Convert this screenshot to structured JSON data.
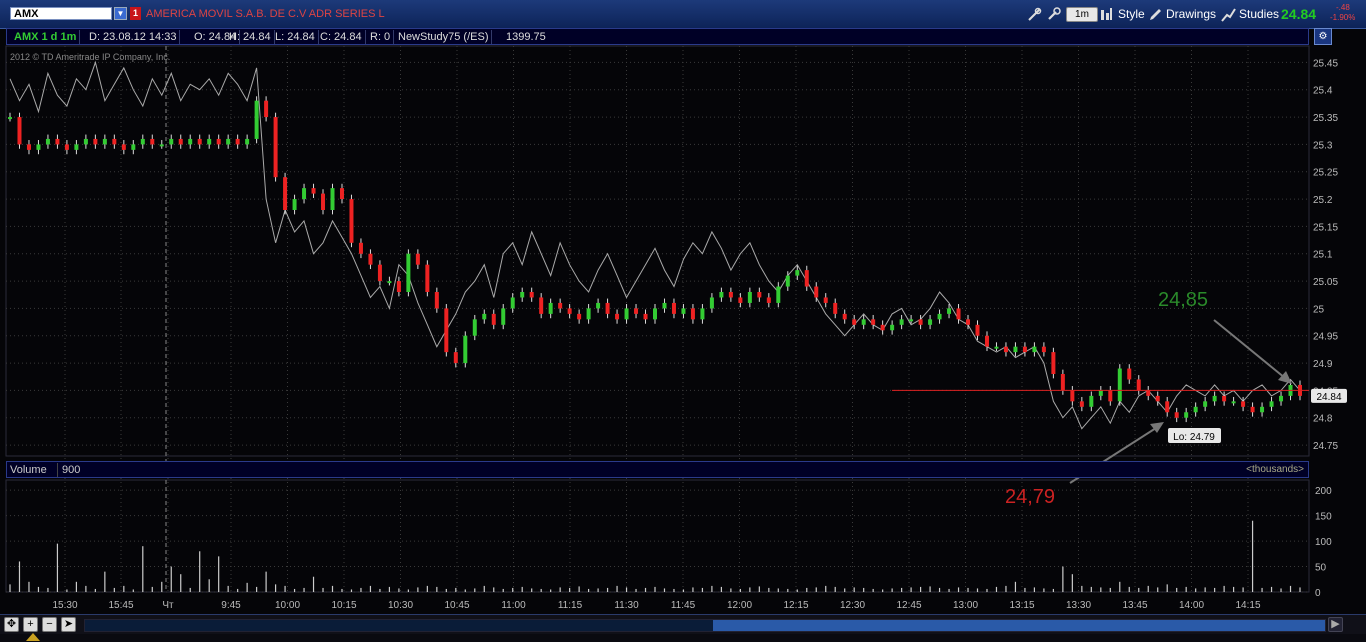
{
  "toolbar": {
    "symbol": "AMX",
    "company": "AMERICA MOVIL S.A.B. DE C.V ADR SERIES L",
    "interval": "1m",
    "style_label": "Style",
    "drawings_label": "Drawings",
    "studies_label": "Studies",
    "last_price": "24.84",
    "change_abs": "-.48",
    "change_pct": "-1.90%"
  },
  "info_bar": {
    "symbol_period": "AMX 1 d 1m",
    "date": "D: 23.08.12 14:33",
    "open": "O: 24.84",
    "high": "H: 24.84",
    "low": "L: 24.84",
    "close": "C: 24.84",
    "range": "R: 0",
    "study": "NewStudy75 (/ES)",
    "study_value": "1399.75"
  },
  "copyright": "2012 © TD Ameritrade IP Company, Inc.",
  "volume_panel": {
    "label": "Volume",
    "value": "900",
    "units": "<thousands>",
    "ticks": [
      "200",
      "150",
      "100",
      "50",
      "0"
    ]
  },
  "price_axis": {
    "ticks": [
      "25.45",
      "25.4",
      "25.35",
      "25.3",
      "25.25",
      "25.2",
      "25.15",
      "25.1",
      "25.05",
      "25",
      "24.95",
      "24.9",
      "24.85",
      "24.8",
      "24.75"
    ],
    "current_label": "24.84"
  },
  "time_axis": {
    "ticks": [
      "15:30",
      "15:45",
      "Чт",
      "9:45",
      "10:00",
      "10:15",
      "10:30",
      "10:45",
      "11:00",
      "11:15",
      "11:30",
      "11:45",
      "12:00",
      "12:15",
      "12:30",
      "12:45",
      "13:00",
      "13:15",
      "13:30",
      "13:45",
      "14:00",
      "14:15"
    ]
  },
  "annotations": {
    "low_label": "Lo: 24.79",
    "high_note": "24,85",
    "low_note": "24,79"
  },
  "colors": {
    "up": "#33cc33",
    "down": "#ee2222",
    "study_line": "#aaaaaa",
    "grid": "#3a3a3a",
    "axis_text": "#bbbbbb",
    "high_note": "#2a8a2a",
    "low_note": "#cc2222"
  },
  "chart_data": {
    "type": "line",
    "ylim": [
      24.73,
      25.48
    ],
    "close": [
      25.35,
      25.3,
      25.29,
      25.3,
      25.31,
      25.3,
      25.29,
      25.3,
      25.31,
      25.3,
      25.31,
      25.3,
      25.29,
      25.3,
      25.31,
      25.3,
      25.3,
      25.31,
      25.3,
      25.31,
      25.3,
      25.31,
      25.3,
      25.31,
      25.3,
      25.31,
      25.38,
      25.35,
      25.24,
      25.18,
      25.2,
      25.22,
      25.21,
      25.18,
      25.22,
      25.2,
      25.12,
      25.1,
      25.08,
      25.05,
      25.05,
      25.03,
      25.1,
      25.08,
      25.03,
      25.0,
      24.92,
      24.9,
      24.95,
      24.98,
      24.99,
      24.97,
      25.0,
      25.02,
      25.03,
      25.02,
      24.99,
      25.01,
      25.0,
      24.99,
      24.98,
      25.0,
      25.01,
      24.99,
      24.98,
      25.0,
      24.99,
      24.98,
      25.0,
      25.01,
      24.99,
      25.0,
      24.98,
      25.0,
      25.02,
      25.03,
      25.02,
      25.01,
      25.03,
      25.02,
      25.01,
      25.04,
      25.06,
      25.07,
      25.04,
      25.02,
      25.01,
      24.99,
      24.98,
      24.97,
      24.98,
      24.97,
      24.96,
      24.97,
      24.98,
      24.98,
      24.97,
      24.98,
      24.99,
      25.0,
      24.98,
      24.97,
      24.95,
      24.93,
      24.93,
      24.92,
      24.93,
      24.92,
      24.93,
      24.92,
      24.88,
      24.85,
      24.83,
      24.82,
      24.84,
      24.85,
      24.83,
      24.89,
      24.87,
      24.85,
      24.84,
      24.83,
      24.81,
      24.8,
      24.81,
      24.82,
      24.83,
      24.84,
      24.83,
      24.83,
      24.82,
      24.81,
      24.82,
      24.83,
      24.84,
      24.86,
      24.84
    ],
    "study_line": [
      25.42,
      25.38,
      25.41,
      25.36,
      25.43,
      25.39,
      25.37,
      25.42,
      25.4,
      25.45,
      25.38,
      25.41,
      25.44,
      25.4,
      25.37,
      25.42,
      25.39,
      25.43,
      25.38,
      25.41,
      25.4,
      25.42,
      25.39,
      25.43,
      25.41,
      25.38,
      25.44,
      25.2,
      25.12,
      25.18,
      25.14,
      25.16,
      25.1,
      25.12,
      25.16,
      25.13,
      25.1,
      25.06,
      25.02,
      25.04,
      25.0,
      25.08,
      25.06,
      25.01,
      24.97,
      24.93,
      24.96,
      24.99,
      25.03,
      25.05,
      25.08,
      25.02,
      25.1,
      25.12,
      25.08,
      25.14,
      25.1,
      25.06,
      25.12,
      25.08,
      25.05,
      25.03,
      25.07,
      25.1,
      25.06,
      25.02,
      25.05,
      25.08,
      25.11,
      25.07,
      25.04,
      25.09,
      25.12,
      25.1,
      25.14,
      25.11,
      25.07,
      25.1,
      25.12,
      25.08,
      25.05,
      25.03,
      25.06,
      25.08,
      25.05,
      25.02,
      24.99,
      24.97,
      24.95,
      24.97,
      24.99,
      24.97,
      24.96,
      24.99,
      25.0,
      24.97,
      24.98,
      25.0,
      25.03,
      25.01,
      24.98,
      24.97,
      24.94,
      24.93,
      24.92,
      24.93,
      24.91,
      24.92,
      24.93,
      24.9,
      24.83,
      24.8,
      24.82,
      24.78,
      24.8,
      24.82,
      24.79,
      24.83,
      24.81,
      24.84,
      24.85,
      24.83,
      24.81,
      24.84,
      24.86,
      24.85,
      24.84,
      24.86,
      24.84,
      24.85,
      24.83,
      24.85,
      24.86,
      24.84,
      24.85,
      24.87,
      24.85
    ],
    "volume_thousands": [
      15,
      60,
      20,
      10,
      8,
      95,
      5,
      20,
      12,
      6,
      40,
      8,
      12,
      5,
      90,
      10,
      20,
      50,
      35,
      8,
      80,
      25,
      70,
      12,
      6,
      18,
      10,
      40,
      15,
      12,
      6,
      8,
      30,
      8,
      12,
      6,
      5,
      8,
      12,
      6,
      10,
      7,
      5,
      9,
      12,
      10,
      6,
      8,
      5,
      7,
      12,
      9,
      6,
      8,
      10,
      7,
      6,
      5,
      9,
      8,
      11,
      6,
      7,
      8,
      12,
      9,
      6,
      8,
      10,
      7,
      6,
      5,
      9,
      8,
      12,
      10,
      7,
      6,
      9,
      11,
      8,
      7,
      6,
      5,
      8,
      9,
      12,
      10,
      7,
      9,
      8,
      6,
      5,
      7,
      8,
      9,
      10,
      11,
      8,
      6,
      9,
      8,
      7,
      6,
      10,
      12,
      20,
      8,
      9,
      7,
      6,
      50,
      35,
      12,
      10,
      9,
      8,
      20,
      10,
      8,
      12,
      9,
      15,
      8,
      10,
      7,
      9,
      8,
      12,
      10,
      9,
      140,
      8,
      10,
      7,
      12,
      9
    ]
  }
}
